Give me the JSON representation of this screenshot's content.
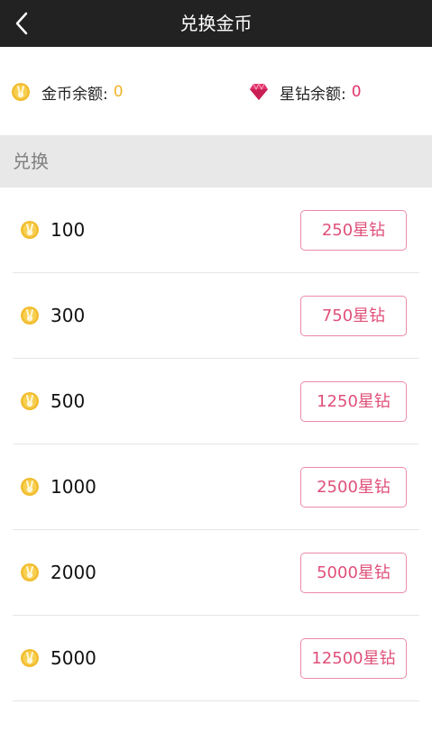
{
  "header": {
    "title": "兑换金币"
  },
  "balance": {
    "coin_label": "金币余额:",
    "coin_value": "0",
    "diamond_label": "星钻余额:",
    "diamond_value": "0"
  },
  "section": {
    "title": "兑换"
  },
  "items": [
    {
      "amount": "100",
      "price": "250星钻"
    },
    {
      "amount": "300",
      "price": "750星钻"
    },
    {
      "amount": "500",
      "price": "1250星钻"
    },
    {
      "amount": "1000",
      "price": "2500星钻"
    },
    {
      "amount": "2000",
      "price": "5000星钻"
    },
    {
      "amount": "5000",
      "price": "12500星钻"
    }
  ],
  "colors": {
    "topbar": "#222222",
    "coin": "#f0b428",
    "diamond": "#e2336b",
    "button_border": "#ec8aa6",
    "button_text": "#e0507a",
    "section_bg": "#e8e8e8"
  },
  "icons": {
    "back": "chevron-left-icon",
    "coin": "coin-icon",
    "diamond": "diamond-icon"
  }
}
